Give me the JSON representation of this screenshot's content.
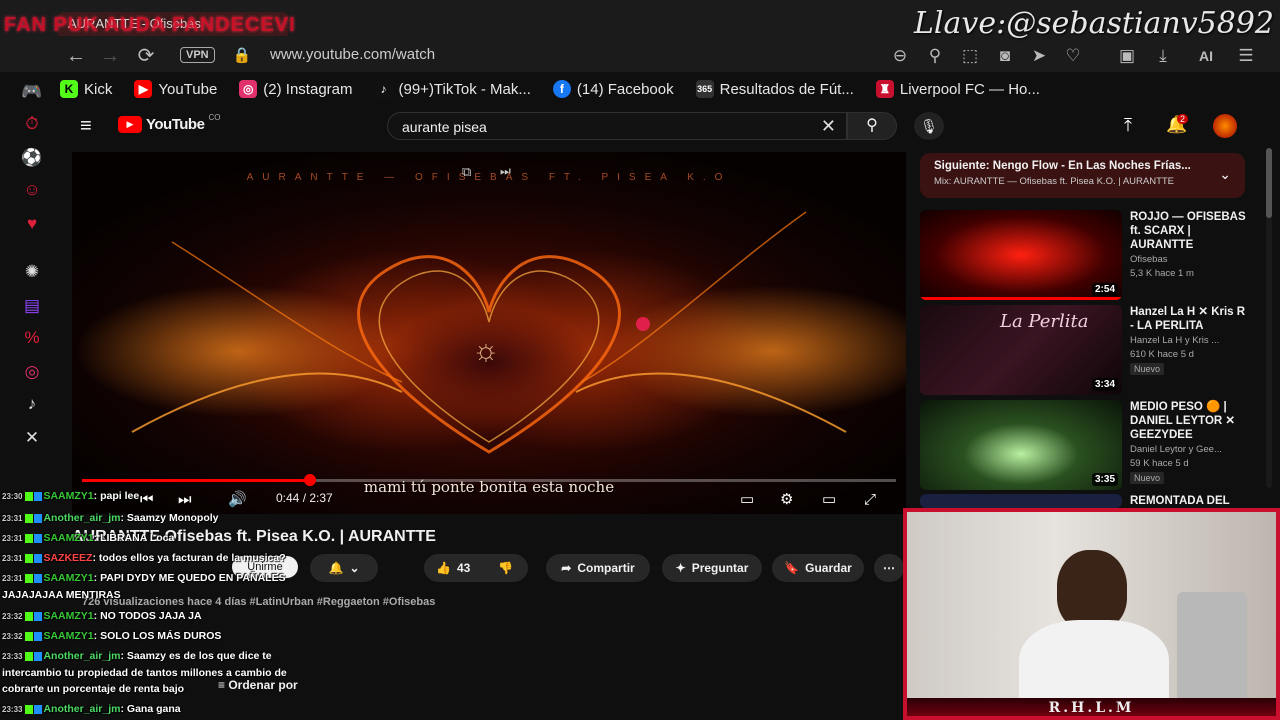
{
  "overlay": {
    "title": "FAN PUK AUDA FANDECEVI",
    "streamer_tag": "Llave:@sebastianv5892",
    "cam_label": "R.H.L.M"
  },
  "browser": {
    "tab_title": "AURANTTE - Ofisebas",
    "vpn_label": "VPN",
    "url": "www.youtube.com/watch",
    "ai_label": "AI",
    "bookmarks": [
      {
        "label": "Kick",
        "color": "#53fc18"
      },
      {
        "label": "YouTube",
        "color": "#ff0000"
      },
      {
        "label": "(2) Instagram",
        "color": "#e1306c"
      },
      {
        "label": "(99+)TikTok - Mak...",
        "color": "#111111"
      },
      {
        "label": "(14) Facebook",
        "color": "#1877f2"
      },
      {
        "label": "Resultados de Fút...",
        "color": "#333333"
      },
      {
        "label": "Liverpool FC — Ho...",
        "color": "#c8102e"
      }
    ]
  },
  "youtube": {
    "logo": "YouTube",
    "logo_region": "CO",
    "search_query": "aurante pisea",
    "notif_count": "2"
  },
  "video": {
    "top_caption": "AURANTTE — OFISEBAS FT. PISEA K.O",
    "subtitle": "mami tú ponte bonita esta noche",
    "time": "0:44 / 2:37",
    "progress": 0.28,
    "title": "AURANTTE Ofisebas ft. Pisea K.O. | AURANTTE",
    "subscribe": "Unirme",
    "likes": "43",
    "share": "Compartir",
    "ask": "Preguntar",
    "save": "Guardar",
    "views": "726 visualizaciones  hace 4 días  #LatinUrban #Reggaeton #Ofisebas",
    "order_by": "Ordenar por"
  },
  "chat": [
    {
      "time": "23:30",
      "user": "SAAMZY1",
      "text": ": papi lee",
      "cls": "uname-s"
    },
    {
      "time": "23:31",
      "user": "Another_air_jm",
      "text": ": Saamzy Monopoly",
      "cls": "uname-a"
    },
    {
      "time": "23:31",
      "user": "SAAMZY1",
      "text": ": LIBRANA Loca",
      "cls": "uname-s"
    },
    {
      "time": "23:31",
      "user": "SAZKEEZ",
      "text": ": todos ellos ya facturan de la musica?",
      "cls": "uname-z"
    },
    {
      "time": "23:31",
      "user": "SAAMZY1",
      "text": ": PAPI DYDY ME QUEDO EN PAÑALES",
      "cls": "uname-s"
    },
    {
      "time": "",
      "user": "",
      "text": "JAJAJAJAA MENTIRAS",
      "cls": ""
    },
    {
      "time": "23:32",
      "user": "SAAMZY1",
      "text": ": NO TODOS JAJA JA",
      "cls": "uname-s"
    },
    {
      "time": "23:32",
      "user": "SAAMZY1",
      "text": ": SOLO LOS MÁS DUROS",
      "cls": "uname-s"
    },
    {
      "time": "23:33",
      "user": "Another_air_jm",
      "text": ": Saamzy es de los que dice te",
      "cls": "uname-a"
    },
    {
      "time": "",
      "user": "",
      "text": "intercambio tu propiedad de tantos millones a cambio de",
      "cls": ""
    },
    {
      "time": "",
      "user": "",
      "text": "cobrarte un porcentaje de renta bajo",
      "cls": ""
    },
    {
      "time": "23:33",
      "user": "Another_air_jm",
      "text": ": Gana gana",
      "cls": "uname-a"
    }
  ],
  "sidebar_right": {
    "upnext_title": "Siguiente: Ñengo Flow - En Las Noches Frías...",
    "upnext_sub": "Mix: AURANTTE — Ofisebas ft. Pisea K.O. | AURANTTE",
    "recs": [
      {
        "title": "ROJJO — OFISEBAS ft. SCARX | AURANTTE",
        "channel": "Ofisebas",
        "meta": "5,3 K  hace 1 m",
        "duration": "2:54",
        "new": ""
      },
      {
        "title": "Hanzel La H ✕ Kris R - LA PERLITA",
        "channel": "Hanzel La H y Kris ...",
        "meta": "610 K  hace 5 d",
        "duration": "3:34",
        "new": "Nuevo"
      },
      {
        "title": "MEDIO PESO 🟠 | DANIEL LEYTOR ✕ GEEZYDEE",
        "channel": "Daniel Leytor y Gee...",
        "meta": "59 K  hace 5 d",
        "duration": "3:35",
        "new": "Nuevo"
      },
      {
        "title": "REMONTADA DEL",
        "channel": "",
        "meta": "",
        "duration": "",
        "new": ""
      }
    ]
  }
}
